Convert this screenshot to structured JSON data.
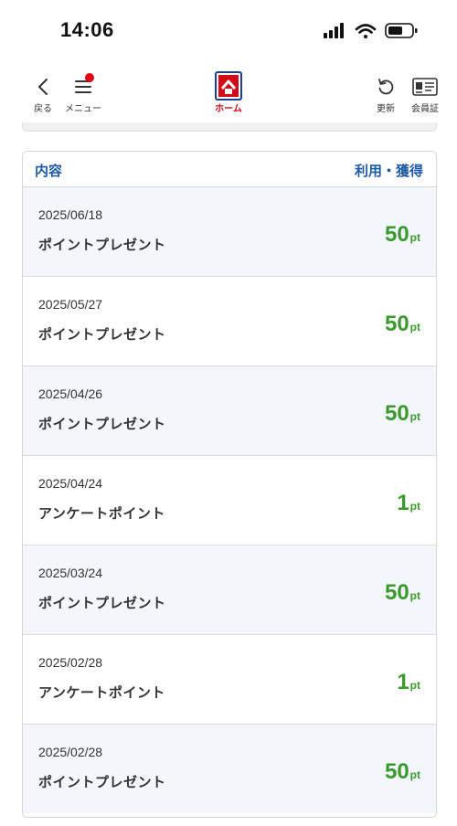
{
  "status": {
    "time": "14:06"
  },
  "nav": {
    "back_label": "戻る",
    "menu_label": "メニュー",
    "home_label": "ホーム",
    "refresh_label": "更新",
    "member_label": "会員証"
  },
  "history": {
    "header_left": "内容",
    "header_right": "利用・獲得",
    "rows": [
      {
        "date": "2025/06/18",
        "desc": "ポイントプレゼント",
        "points": "50",
        "unit": "pt"
      },
      {
        "date": "2025/05/27",
        "desc": "ポイントプレゼント",
        "points": "50",
        "unit": "pt"
      },
      {
        "date": "2025/04/26",
        "desc": "ポイントプレゼント",
        "points": "50",
        "unit": "pt"
      },
      {
        "date": "2025/04/24",
        "desc": "アンケートポイント",
        "points": "1",
        "unit": "pt"
      },
      {
        "date": "2025/03/24",
        "desc": "ポイントプレゼント",
        "points": "50",
        "unit": "pt"
      },
      {
        "date": "2025/02/28",
        "desc": "アンケートポイント",
        "points": "1",
        "unit": "pt"
      },
      {
        "date": "2025/02/28",
        "desc": "ポイントプレゼント",
        "points": "50",
        "unit": "pt"
      }
    ]
  },
  "colors": {
    "accent_blue": "#1d5aa6",
    "points_green": "#3a9a2d",
    "brand_red": "#d30b16"
  }
}
